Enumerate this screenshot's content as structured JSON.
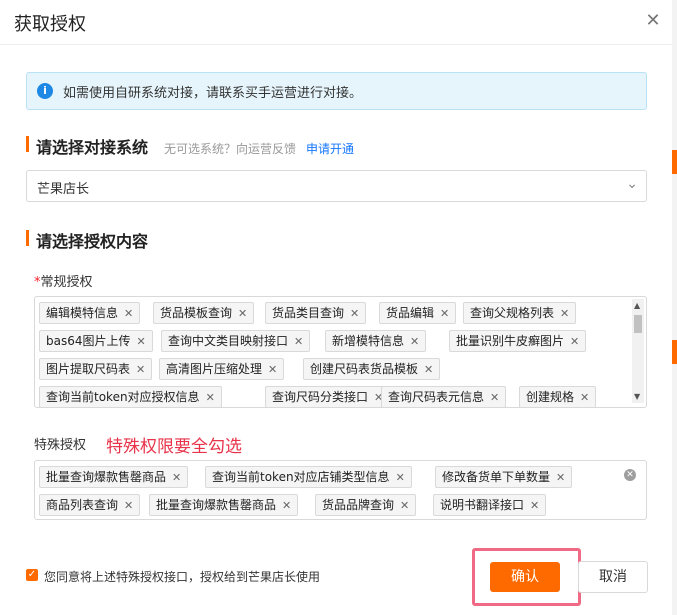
{
  "dialog": {
    "title": "获取授权",
    "close_icon": "close-icon"
  },
  "notice": {
    "icon": "info-icon",
    "text": "如需使用自研系统对接，请联系买手运营进行对接。"
  },
  "system_section": {
    "title": "请选择对接系统",
    "hint": "无可选系统？向运营反馈",
    "link": "申请开通",
    "selected": "芒果店长"
  },
  "content_section": {
    "title": "请选择授权内容"
  },
  "regular": {
    "required_mark": "*",
    "label": "常规授权",
    "tags": [
      "编辑模特信息",
      "货品模板查询",
      "货品类目查询",
      "货品编辑",
      "查询父规格列表",
      "bas64图片上传",
      "查询中文类目映射接口",
      "新增模特信息",
      "批量识别牛皮癣图片",
      "图片提取尺码表",
      "高清图片压缩处理",
      "创建尺码表货品模板",
      "查询当前token对应授权信息",
      "查询尺码分类接口",
      "查询尺码表元信息",
      "创建规格"
    ]
  },
  "special": {
    "label": "特殊授权",
    "annotation": "特殊权限要全勾选",
    "tags": [
      "批量查询爆款售罄商品",
      "查询当前token对应店铺类型信息",
      "修改备货单下单数量",
      "商品列表查询",
      "批量查询爆款售罄商品",
      "货品品牌查询",
      "说明书翻译接口"
    ]
  },
  "footer": {
    "agree_text": "您同意将上述特殊授权接口，授权给到芒果店长使用",
    "ok": "确认",
    "cancel": "取消",
    "accent": "#ff6a00"
  }
}
